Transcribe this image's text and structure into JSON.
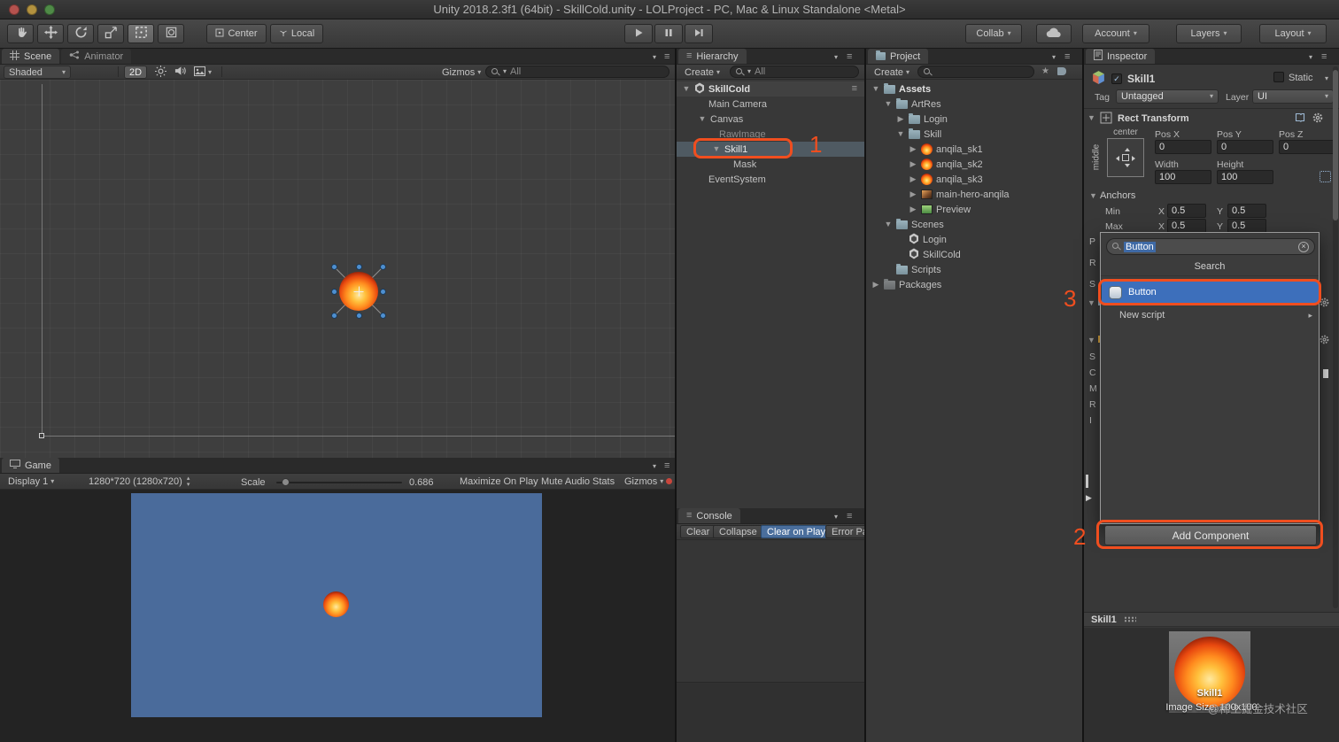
{
  "titlebar": {
    "title": "Unity 2018.2.3f1 (64bit) - SkillCold.unity - LOLProject - PC, Mac & Linux Standalone <Metal>"
  },
  "toolbar": {
    "center": "Center",
    "local": "Local",
    "collab": "Collab",
    "account": "Account",
    "layers": "Layers",
    "layout": "Layout"
  },
  "scene_panel": {
    "tab_scene": "Scene",
    "tab_animator": "Animator",
    "shaded": "Shaded",
    "mode_2d": "2D",
    "gizmos": "Gizmos",
    "search_text": "All"
  },
  "game_panel": {
    "tab": "Game",
    "display": "Display 1",
    "resolution": "1280*720 (1280x720)",
    "scale_label": "Scale",
    "scale_value": "0.686",
    "maximize": "Maximize On Play",
    "mute": "Mute Audio",
    "stats": "Stats",
    "gizmos": "Gizmos"
  },
  "hierarchy": {
    "tab": "Hierarchy",
    "create": "Create",
    "search_text": "All",
    "scene_row": "SkillCold",
    "items": [
      {
        "label": "Main Camera"
      },
      {
        "label": "Canvas"
      },
      {
        "label": "RawImage"
      },
      {
        "label": "Skill1"
      },
      {
        "label": "Mask"
      },
      {
        "label": "EventSystem"
      }
    ]
  },
  "console": {
    "tab": "Console",
    "clear": "Clear",
    "collapse": "Collapse",
    "clear_on_play": "Clear on Play",
    "error_pause": "Error Pau"
  },
  "project": {
    "tab": "Project",
    "create": "Create",
    "items": [
      {
        "label": "Assets"
      },
      {
        "label": "ArtRes"
      },
      {
        "label": "Login"
      },
      {
        "label": "Skill"
      },
      {
        "label": "anqila_sk1"
      },
      {
        "label": "anqila_sk2"
      },
      {
        "label": "anqila_sk3"
      },
      {
        "label": "main-hero-anqila"
      },
      {
        "label": "Preview"
      },
      {
        "label": "Scenes"
      },
      {
        "label": "Login"
      },
      {
        "label": "SkillCold"
      },
      {
        "label": "Scripts"
      },
      {
        "label": "Packages"
      }
    ]
  },
  "inspector": {
    "tab": "Inspector",
    "name": "Skill1",
    "static_label": "Static",
    "tag_label": "Tag",
    "tag_value": "Untagged",
    "layer_label": "Layer",
    "layer_value": "UI",
    "rect": {
      "title": "Rect Transform",
      "anchor_h": "center",
      "anchor_v": "middle",
      "posx_label": "Pos X",
      "posy_label": "Pos Y",
      "posz_label": "Pos Z",
      "posx": "0",
      "posy": "0",
      "posz": "0",
      "width_label": "Width",
      "height_label": "Height",
      "width": "100",
      "height": "100",
      "anchors": "Anchors",
      "min": "Min",
      "max": "Max",
      "x": "X",
      "y": "Y",
      "minx": "0.5",
      "miny": "0.5",
      "maxx": "0.5",
      "maxy": "0.5"
    },
    "strip": [
      "P",
      "R",
      "S",
      "S",
      "C",
      "M",
      "R",
      "I"
    ],
    "popup": {
      "search_value": "Button",
      "header": "Search",
      "result": "Button",
      "new_script": "New script"
    },
    "add_component": "Add Component",
    "preview": {
      "bar_title": "Skill1",
      "image_label": "Skill1",
      "size": "Image Size: 100x100"
    }
  },
  "annotations": {
    "one": "1",
    "two": "2",
    "three": "3"
  },
  "watermark": "@稀土掘金技术社区",
  "icons": {
    "tri_down": "▼",
    "tri_right": "▶",
    "chev_down": "▾",
    "chev_up": "▴",
    "menu": "≡",
    "close_x": "×",
    "check": "✓",
    "star": "★",
    "arrow_right": "▸"
  },
  "colors": {
    "accent_orange": "#f04e1f",
    "selection_blue": "#3d6fbb",
    "canvas_blue": "#4a6b9b"
  }
}
